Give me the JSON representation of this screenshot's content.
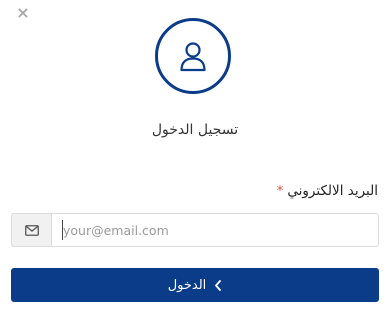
{
  "dialog": {
    "close_glyph": "×",
    "title": "تسجيل الدخول",
    "accent_color": "#0b3c89"
  },
  "avatar": {
    "icon": "user-icon"
  },
  "form": {
    "email_label": "البريد الالكتروني",
    "required_marker": "*",
    "email_icon": "envelope-icon",
    "email_placeholder": "your@email.com",
    "email_value": ""
  },
  "submit": {
    "label": "الدخول",
    "icon": "chevron-left-icon"
  }
}
